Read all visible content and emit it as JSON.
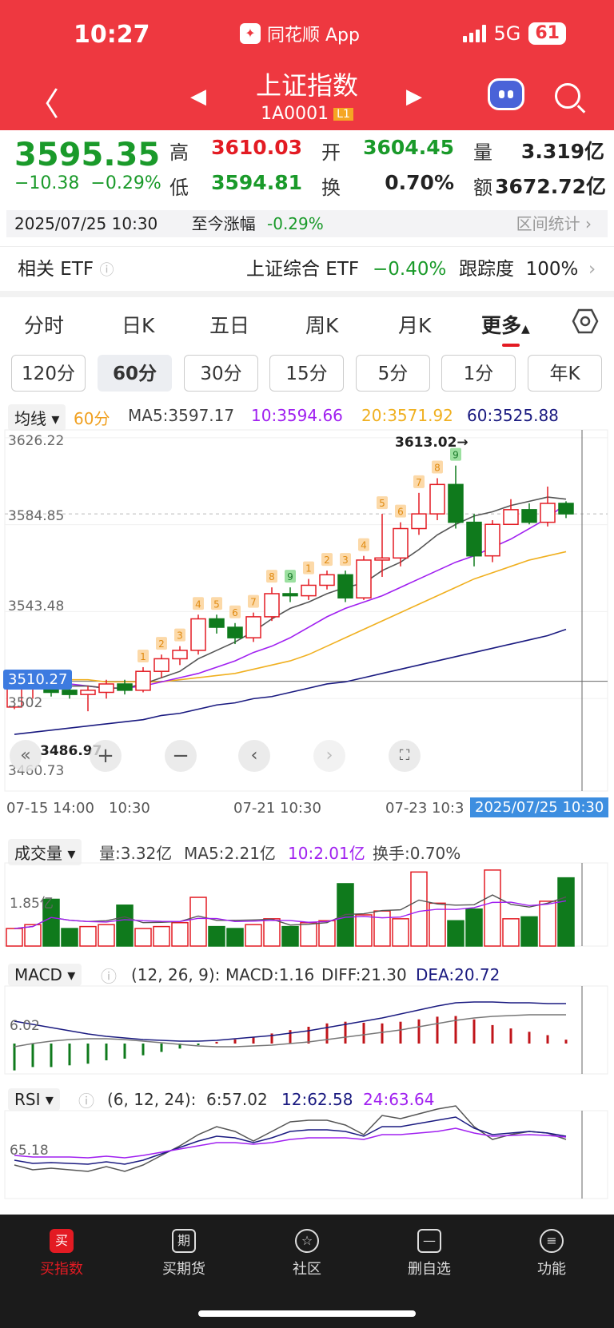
{
  "status": {
    "time": "10:27",
    "app": "同花顺 App",
    "network": "5G",
    "battery": "61"
  },
  "header": {
    "title": "上证指数",
    "code": "1A0001",
    "level": "L1"
  },
  "quote": {
    "price": "3595.35",
    "change": "−10.38",
    "change_pct": "−0.29%",
    "high_label": "高",
    "high": "3610.03",
    "open_label": "开",
    "open": "3604.45",
    "vol_label": "量",
    "vol": "3.319亿",
    "low_label": "低",
    "low": "3594.81",
    "turn_label": "换",
    "turn": "0.70%",
    "amt_label": "额",
    "amt": "3672.72亿",
    "datetime": "2025/07/25 10:30",
    "since_label": "至今涨幅",
    "since": "-0.29%",
    "range_stats": "区间统计"
  },
  "etf": {
    "label": "相关 ETF",
    "name": "上证综合 ETF",
    "change": "−0.40%",
    "track_label": "跟踪度",
    "track": "100%"
  },
  "tabs": [
    "分时",
    "日K",
    "五日",
    "周K",
    "月K",
    "更多"
  ],
  "minute_tabs": [
    "120分",
    "60分",
    "30分",
    "15分",
    "5分",
    "1分",
    "年K"
  ],
  "ma_line": {
    "dropdown": "均线",
    "period": "60分",
    "ma5": "MA5:3597.17",
    "ma10": "10:3594.66",
    "ma20": "20:3571.92",
    "ma60": "60:3525.88"
  },
  "kline": {
    "y_labels": [
      "3626.22",
      "3584.85",
      "3543.48",
      "3460.73"
    ],
    "cursor_price": "3510.27",
    "hidden_low": "3502",
    "low_mark": "3486.97",
    "high_mark": "3613.02→",
    "x_labels": [
      "07-15 14:00",
      "10:30",
      "07-21 10:30",
      "07-23 10:3",
      "2025/07/25 10:30"
    ],
    "candles": [
      [
        3498,
        3509,
        3497,
        3510
      ],
      [
        3510,
        3512,
        3502,
        3514
      ],
      [
        3512,
        3505,
        3503,
        3514
      ],
      [
        3506,
        3504,
        3502,
        3509
      ],
      [
        3504,
        3506,
        3496,
        3508
      ],
      [
        3505,
        3509,
        3502,
        3511
      ],
      [
        3509,
        3506,
        3504,
        3511
      ],
      [
        3506,
        3515,
        3505,
        3517
      ],
      [
        3515,
        3521,
        3512,
        3523
      ],
      [
        3521,
        3525,
        3518,
        3527
      ],
      [
        3525,
        3540,
        3523,
        3542
      ],
      [
        3540,
        3536,
        3533,
        3542
      ],
      [
        3536,
        3531,
        3528,
        3538
      ],
      [
        3531,
        3541,
        3529,
        3543
      ],
      [
        3541,
        3552,
        3539,
        3555
      ],
      [
        3552,
        3551,
        3548,
        3555
      ],
      [
        3551,
        3556,
        3549,
        3559
      ],
      [
        3556,
        3561,
        3554,
        3563
      ],
      [
        3561,
        3550,
        3548,
        3563
      ],
      [
        3550,
        3568,
        3549,
        3570
      ],
      [
        3568,
        3569,
        3560,
        3590
      ],
      [
        3569,
        3583,
        3565,
        3586
      ],
      [
        3583,
        3590,
        3580,
        3600
      ],
      [
        3590,
        3604,
        3587,
        3607
      ],
      [
        3604,
        3586,
        3583,
        3613
      ],
      [
        3586,
        3570,
        3565,
        3590
      ],
      [
        3570,
        3585,
        3567,
        3587
      ],
      [
        3585,
        3592,
        3585,
        3597
      ],
      [
        3592,
        3586,
        3585,
        3595
      ],
      [
        3586,
        3595,
        3584,
        3603
      ],
      [
        3595,
        3590,
        3588,
        3596
      ]
    ],
    "ma_lines": {
      "ma5": [
        3506,
        3508,
        3508,
        3508,
        3508,
        3507,
        3507,
        3509,
        3512,
        3515,
        3521,
        3525,
        3529,
        3534,
        3540,
        3545,
        3548,
        3552,
        3555,
        3557,
        3563,
        3567,
        3573,
        3580,
        3585,
        3589,
        3591,
        3594,
        3596,
        3598,
        3597
      ],
      "ma10": [
        3514,
        3512,
        3510,
        3509,
        3508,
        3507,
        3507,
        3508,
        3510,
        3512,
        3514,
        3517,
        3520,
        3524,
        3527,
        3531,
        3536,
        3541,
        3545,
        3548,
        3551,
        3555,
        3559,
        3563,
        3567,
        3570,
        3574,
        3578,
        3583,
        3588,
        3595
      ],
      "ma20": [
        3512,
        3511,
        3511,
        3511,
        3511,
        3510,
        3510,
        3510,
        3510,
        3511,
        3512,
        3513,
        3514,
        3516,
        3518,
        3520,
        3523,
        3527,
        3531,
        3535,
        3539,
        3543,
        3547,
        3551,
        3555,
        3559,
        3562,
        3565,
        3568,
        3570,
        3572
      ],
      "ma60": [
        3485,
        3486,
        3487,
        3488,
        3489,
        3490,
        3491,
        3492,
        3494,
        3495,
        3497,
        3499,
        3500,
        3502,
        3503,
        3505,
        3507,
        3509,
        3510,
        3512,
        3514,
        3516,
        3518,
        3520,
        3522,
        3524,
        3526,
        3528,
        3530,
        3532,
        3535
      ]
    },
    "counts": [
      "",
      "",
      "",
      "",
      "",
      "",
      "",
      "1",
      "2",
      "3",
      "4",
      "5",
      "6",
      "7",
      "8",
      "9",
      "1",
      "2",
      "3",
      "4",
      "5",
      "6",
      "7",
      "8",
      "9",
      "",
      "",
      "",
      "",
      "",
      ""
    ]
  },
  "volume": {
    "dropdown": "成交量",
    "vol": "量:3.32亿",
    "ma5": "MA5:2.21亿",
    "ma10": "10:2.01亿",
    "turnover": "换手:0.70%",
    "y_label": "1.85亿",
    "bars": [
      0.9,
      1.1,
      2.4,
      0.9,
      1.0,
      1.1,
      2.1,
      0.9,
      1.0,
      1.2,
      2.5,
      1.0,
      0.9,
      1.1,
      1.4,
      1.0,
      1.2,
      1.3,
      3.2,
      1.6,
      1.8,
      1.4,
      3.8,
      2.2,
      1.3,
      1.9,
      3.9,
      1.4,
      1.5,
      2.3,
      3.5
    ]
  },
  "macd": {
    "dropdown": "MACD",
    "params": "(12, 26, 9):",
    "macd": "MACD:1.16",
    "diff": "DIFF:21.30",
    "dea": "DEA:20.72",
    "y_label": "6.02",
    "hist": [
      -8,
      -7,
      -7,
      -6.5,
      -6,
      -5,
      -4.5,
      -3.5,
      -2.5,
      -1.5,
      -0.5,
      0.5,
      1.2,
      2,
      3,
      4,
      5,
      6,
      6.5,
      6.2,
      6,
      6.5,
      7.2,
      8,
      8.2,
      7.2,
      5.5,
      4.5,
      3.5,
      2.5,
      1.16
    ]
  },
  "rsi": {
    "dropdown": "RSI",
    "params": "(6, 12, 24):",
    "rsi6": "6:57.02",
    "rsi12": "12:62.58",
    "rsi24": "24:63.64",
    "y_label": "65.18"
  },
  "nav": [
    {
      "icon": "买",
      "label": "买指数"
    },
    {
      "icon": "期",
      "label": "买期货"
    },
    {
      "icon": "☆",
      "label": "社区"
    },
    {
      "icon": "—",
      "label": "删自选"
    },
    {
      "icon": "≡",
      "label": "功能"
    }
  ],
  "colors": {
    "header": "#ee3840",
    "up": "#e31b23",
    "down": "#0f7a1c",
    "ma5": "#555555",
    "ma10": "#a020f0",
    "ma20": "#f0b020",
    "ma60": "#1a1a80"
  }
}
